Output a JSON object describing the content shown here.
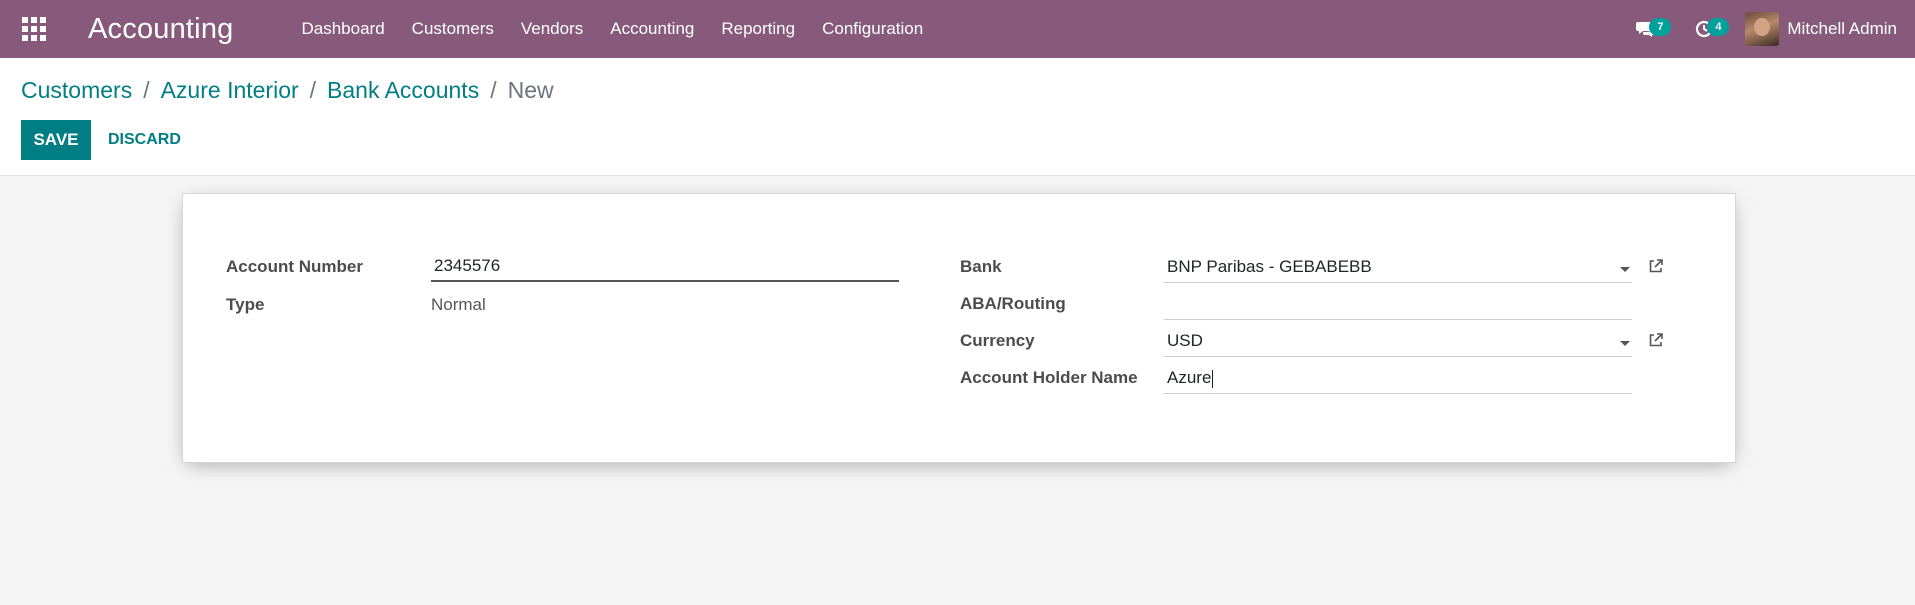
{
  "navbar": {
    "brand": "Accounting",
    "menu": [
      "Dashboard",
      "Customers",
      "Vendors",
      "Accounting",
      "Reporting",
      "Configuration"
    ],
    "messages_count": "7",
    "activities_count": "4",
    "user_name": "Mitchell Admin",
    "color": "#875a7b"
  },
  "breadcrumb": {
    "items": [
      "Customers",
      "Azure Interior",
      "Bank Accounts"
    ],
    "separator": "/",
    "current": "New"
  },
  "buttons": {
    "save": "SAVE",
    "discard": "DISCARD"
  },
  "form": {
    "account_number": {
      "label": "Account Number",
      "value": "2345576"
    },
    "type": {
      "label": "Type",
      "value": "Normal"
    },
    "bank": {
      "label": "Bank",
      "value": "BNP Paribas - GEBABEBB"
    },
    "aba_routing": {
      "label": "ABA/Routing",
      "value": ""
    },
    "currency": {
      "label": "Currency",
      "value": "USD"
    },
    "holder_name": {
      "label": "Account Holder Name",
      "value": "Azure"
    }
  },
  "colors": {
    "accent": "#017e84",
    "badge": "#00a09d"
  }
}
